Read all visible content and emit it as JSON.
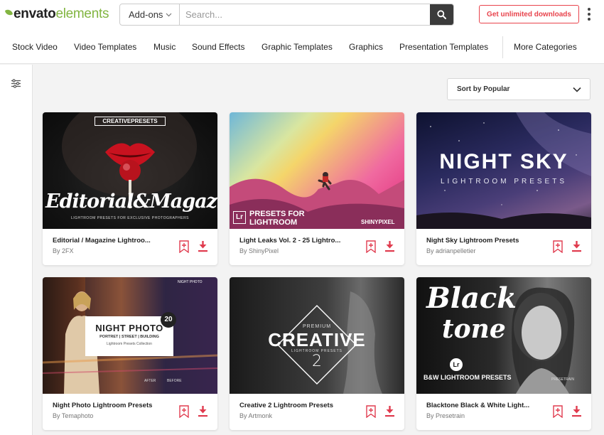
{
  "brand": {
    "word1": "envato",
    "word2": "elements"
  },
  "search": {
    "category": "Add-ons",
    "placeholder": "Search..."
  },
  "cta_label": "Get unlimited downloads",
  "nav": [
    "Stock Video",
    "Video Templates",
    "Music",
    "Sound Effects",
    "Graphic Templates",
    "Graphics",
    "Presentation Templates",
    "More Categories"
  ],
  "sort_label": "Sort by Popular",
  "icons": {
    "logo": "envato-leaf-icon",
    "search": "search-icon",
    "menu": "more-vertical-icon",
    "filter": "filter-sliders-icon",
    "sort": "chevron-down-icon",
    "bookmark": "bookmark-add-icon",
    "download": "download-icon"
  },
  "colors": {
    "brand_green": "#82b541",
    "cta_red": "#e8434c",
    "action_red": "#e03c4f"
  },
  "items": [
    {
      "title": "Editorial / Magazine Lightroo...",
      "author": "By 2FX",
      "thumb": {
        "top": "CREATIVEPRESETS",
        "main": "Editorial&Magazine",
        "sub": "LIGHTROOM PRESETS FOR EXCLUSIVE PHOTOGRAPHERS"
      }
    },
    {
      "title": "Light Leaks Vol. 2 - 25 Lightro...",
      "author": "By ShinyPixel",
      "thumb": {
        "badge": "Lr",
        "line1": "PRESETS FOR",
        "line2": "LIGHTROOM",
        "corner": "SHINYPIXEL"
      }
    },
    {
      "title": "Night Sky Lightroom Presets",
      "author": "By adrianpelletier",
      "thumb": {
        "main": "NIGHT SKY",
        "sub": "LIGHTROOM PRESETS"
      }
    },
    {
      "title": "Night Photo Lightroom Presets",
      "author": "By Temaphoto",
      "thumb": {
        "corner": "NIGHT PHOTO",
        "badge": "20",
        "main": "NIGHT PHOTO",
        "sub": "PORTRET | STREET | BUILDING",
        "sub2": "Lightroom Presets Collection",
        "after": "AFTER",
        "before": "BEFORE"
      }
    },
    {
      "title": "Creative 2 Lightroom Presets",
      "author": "By Artmonk",
      "thumb": {
        "premium": "PREMIUM",
        "main": "CREATIVE",
        "sub": "LIGHTROOM PRESETS",
        "num": "2"
      }
    },
    {
      "title": "Blacktone Black & White Light...",
      "author": "By Presetrain",
      "thumb": {
        "main1": "Black",
        "main2": "tone",
        "badge": "Lr",
        "sub": "B&W LIGHTROOM PRESETS",
        "corner": "PRESETRAIN"
      }
    }
  ]
}
